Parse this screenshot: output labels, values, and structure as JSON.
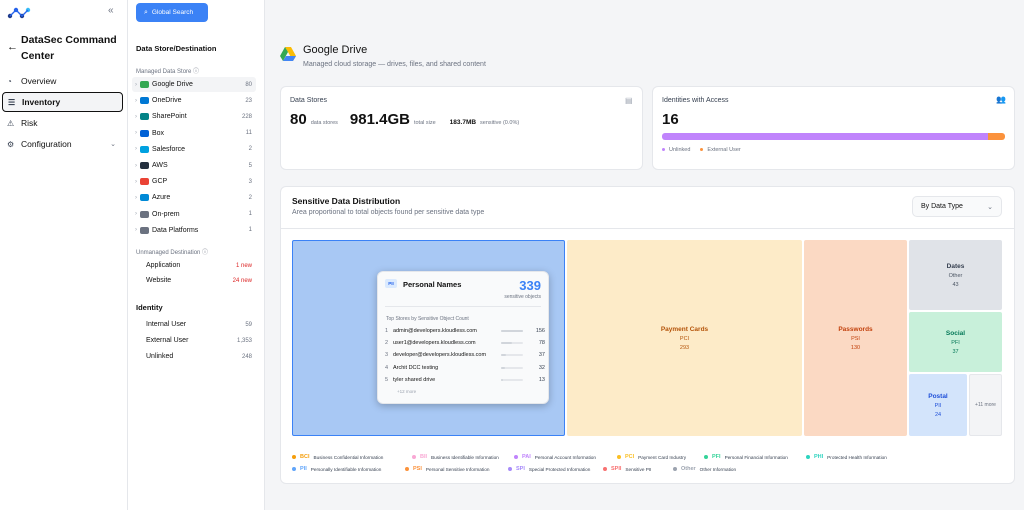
{
  "app": {
    "title": "DataSec Command Center"
  },
  "nav": [
    {
      "label": "Overview",
      "icon": "overview-icon"
    },
    {
      "label": "Inventory",
      "icon": "list-icon"
    },
    {
      "label": "Risk",
      "icon": "risk-icon"
    },
    {
      "label": "Configuration",
      "icon": "config-icon"
    }
  ],
  "search": {
    "label": "Global Search"
  },
  "mid": {
    "heading": "Data Store/Destination",
    "managed_label": "Managed Data Store",
    "managed": [
      {
        "name": "Google Drive",
        "count": "80",
        "color": "#34a853"
      },
      {
        "name": "OneDrive",
        "count": "23",
        "color": "#0078d4"
      },
      {
        "name": "SharePoint",
        "count": "228",
        "color": "#038387"
      },
      {
        "name": "Box",
        "count": "11",
        "color": "#0061d5"
      },
      {
        "name": "Salesforce",
        "count": "2",
        "color": "#00a1e0"
      },
      {
        "name": "AWS",
        "count": "5",
        "color": "#232f3e"
      },
      {
        "name": "GCP",
        "count": "3",
        "color": "#ea4335"
      },
      {
        "name": "Azure",
        "count": "2",
        "color": "#0089d6"
      },
      {
        "name": "On-prem",
        "count": "1",
        "color": "#6b7280"
      },
      {
        "name": "Data Platforms",
        "count": "1",
        "color": "#6b7280"
      }
    ],
    "unmanaged_label": "Unmanaged Destination",
    "unmanaged": [
      {
        "name": "Application",
        "count": "1 new"
      },
      {
        "name": "Website",
        "count": "24 new"
      }
    ],
    "identity_label": "Identity",
    "identity": [
      {
        "name": "Internal User",
        "count": "59"
      },
      {
        "name": "External User",
        "count": "1,353"
      },
      {
        "name": "Unlinked",
        "count": "248"
      }
    ]
  },
  "page": {
    "title": "Google Drive",
    "subtitle": "Managed cloud storage — drives, files, and shared content"
  },
  "stores": {
    "label": "Data Stores",
    "count": "80",
    "count_unit": "data stores",
    "size": "981.4GB",
    "size_unit": "total size",
    "sensitive": "183.7MB",
    "sensitive_unit": "sensitive (0.0%)"
  },
  "identities": {
    "label": "Identities with Access",
    "count": "16",
    "unlinked_fraction": 0.95,
    "legend": [
      {
        "label": "Unlinked",
        "color": "#c084fc"
      },
      {
        "label": "External User",
        "color": "#fb923c"
      }
    ]
  },
  "dist": {
    "title": "Sensitive Data Distribution",
    "subtitle": "Area proportional to total objects found per sensitive data type",
    "dropdown": "By Data Type"
  },
  "treemap": [
    {
      "title": "Payment Cards",
      "code": "PCI",
      "value": "293"
    },
    {
      "title": "Passwords",
      "code": "PSI",
      "value": "130"
    },
    {
      "title": "Dates",
      "code": "Other",
      "value": "43"
    },
    {
      "title": "Social",
      "code": "PFI",
      "value": "37"
    },
    {
      "title": "Postal",
      "code": "PII",
      "value": "24"
    },
    {
      "more": "+11 more"
    }
  ],
  "popup": {
    "badge": "PII",
    "title": "Personal Names",
    "value": "339",
    "value_label": "sensitive objects",
    "list_title": "Top Stores by Sensitive Object Count",
    "rows": [
      {
        "n": "1",
        "name": "admin@developers.kloudless.com",
        "v": "156",
        "f": 1.0
      },
      {
        "n": "2",
        "name": "user1@developers.kloudless.com",
        "v": "78",
        "f": 0.5
      },
      {
        "n": "3",
        "name": "developer@developers.kloudless.com",
        "v": "37",
        "f": 0.24
      },
      {
        "n": "4",
        "name": "Archit DCC testing",
        "v": "32",
        "f": 0.2
      },
      {
        "n": "5",
        "name": "tyler shared drive",
        "v": "13",
        "f": 0.08
      }
    ],
    "more": "+12 more"
  },
  "legend": [
    {
      "code": "BCI",
      "label": "Business Confidential Information",
      "color": "#f59e0b"
    },
    {
      "code": "BII",
      "label": "Business Identifiable Information",
      "color": "#f9a8d4"
    },
    {
      "code": "PAI",
      "label": "Personal Account Information",
      "color": "#c084fc"
    },
    {
      "code": "PCI",
      "label": "Payment Card Industry",
      "color": "#fbbf24"
    },
    {
      "code": "PFI",
      "label": "Personal Financial Information",
      "color": "#34d399"
    },
    {
      "code": "PHI",
      "label": "Protected Health Information",
      "color": "#2dd4bf"
    },
    {
      "code": "PII",
      "label": "Personally Identifiable Information",
      "color": "#60a5fa"
    },
    {
      "code": "PSI",
      "label": "Personal Sensitive Information",
      "color": "#fb923c"
    },
    {
      "code": "SPI",
      "label": "Special Protected Information",
      "color": "#a78bfa"
    },
    {
      "code": "SPII",
      "label": "Sensitive PII",
      "color": "#f87171"
    },
    {
      "code": "Other",
      "label": "Other Information",
      "color": "#9ca3af"
    }
  ]
}
